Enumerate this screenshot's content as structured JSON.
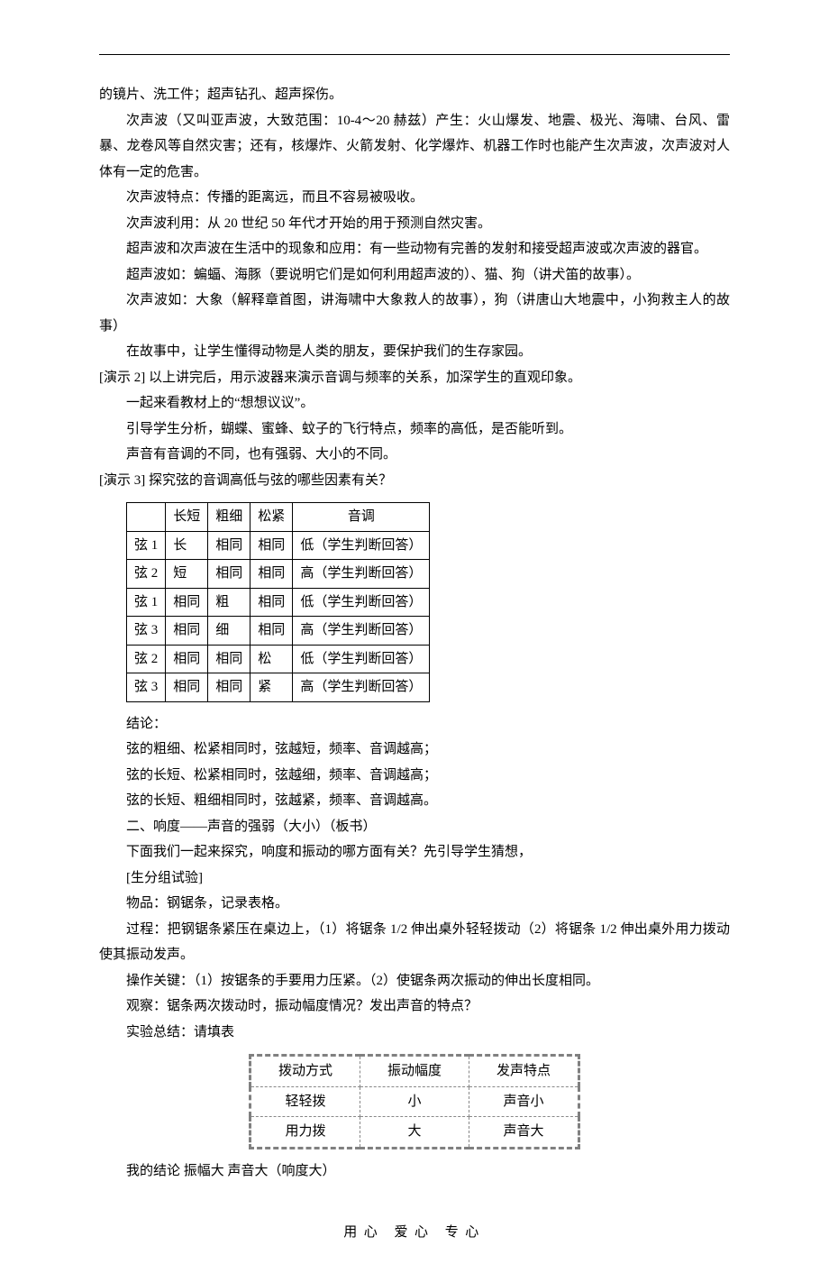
{
  "p": {
    "l01": "的镜片、洗工件；超声钻孔、超声探伤。",
    "l02": "次声波（又叫亚声波，大致范围：10-4～20 赫兹）产生：火山爆发、地震、极光、海啸、台风、雷暴、龙卷风等自然灾害；还有，核爆炸、火箭发射、化学爆炸、机器工作时也能产生次声波，次声波对人体有一定的危害。",
    "l03": "次声波特点：传播的距离远，而且不容易被吸收。",
    "l04": "次声波利用：从 20 世纪 50 年代才开始的用于预测自然灾害。",
    "l05": "超声波和次声波在生活中的现象和应用：有一些动物有完善的发射和接受超声波或次声波的器官。",
    "l06": "超声波如：蝙蝠、海豚（要说明它们是如何利用超声波的）、猫、狗（讲犬笛的故事）。",
    "l07": "次声波如：大象（解释章首图，讲海啸中大象救人的故事），狗（讲唐山大地震中，小狗救主人的故事）",
    "l08": "在故事中，让学生懂得动物是人类的朋友，要保护我们的生存家园。",
    "l09": "[演示 2] 以上讲完后，用示波器来演示音调与频率的关系，加深学生的直观印象。",
    "l10": "一起来看教材上的“想想议议”。",
    "l11": "引导学生分析，蝴蝶、蜜蜂、蚊子的飞行特点，频率的高低，是否能听到。",
    "l12": "声音有音调的不同，也有强弱、大小的不同。",
    "l13": "[演示 3]  探究弦的音调高低与弦的哪些因素有关？",
    "l14": "结论：",
    "l15": "弦的粗细、松紧相同时，弦越短，频率、音调越高；",
    "l16": " 弦的长短、松紧相同时，弦越细，频率、音调越高；",
    "l17": "弦的长短、粗细相同时，弦越紧，频率、音调越高。",
    "l18": "二、响度——声音的强弱（大小）（板书）",
    "l19": "下面我们一起来探究，响度和振动的哪方面有关？先引导学生猜想，",
    "l20": "[生分组试验]",
    "l21": "物品：钢锯条，记录表格。",
    "l22": "过程：把钢锯条紧压在桌边上，（1）将锯条 1/2 伸出桌外轻轻拨动（2）将锯条 1/2 伸出桌外用力拨动 使其振动发声。",
    "l23": "操作关键：（1）按锯条的手要用力压紧。（2）使锯条两次振动的伸出长度相同。",
    "l24": "观察：锯条两次拨动时，振动幅度情况？发出声音的特点？",
    "l25": "实验总结：请填表",
    "l26": "我的结论 振幅大 声音大（响度大）"
  },
  "table1": {
    "headers": [
      "",
      "长短",
      "粗细",
      "松紧",
      "音调"
    ],
    "rows": [
      [
        "弦 1",
        "长",
        "相同",
        "相同",
        "低（学生判断回答）"
      ],
      [
        "弦 2",
        "短",
        "相同",
        "相同",
        "高（学生判断回答）"
      ],
      [
        "弦 1",
        "相同",
        "粗",
        "相同",
        "低（学生判断回答）"
      ],
      [
        "弦 3",
        "相同",
        "细",
        "相同",
        "高（学生判断回答）"
      ],
      [
        "弦 2",
        "相同",
        "相同",
        "松",
        "低（学生判断回答）"
      ],
      [
        "弦 3",
        "相同",
        "相同",
        "紧",
        "高（学生判断回答）"
      ]
    ]
  },
  "table2": {
    "headers": [
      "拨动方式",
      "振动幅度",
      "发声特点"
    ],
    "rows": [
      [
        "轻轻拨",
        "小",
        "声音小"
      ],
      [
        "用力拨",
        "大",
        "声音大"
      ]
    ]
  },
  "footer": "用心 爱心 专心",
  "chart_data": {
    "type": "table",
    "tables": [
      {
        "title": "探究弦的音调高低与弦的哪些因素有关",
        "columns": [
          "弦",
          "长短",
          "粗细",
          "松紧",
          "音调"
        ],
        "rows": [
          [
            "弦 1",
            "长",
            "相同",
            "相同",
            "低"
          ],
          [
            "弦 2",
            "短",
            "相同",
            "相同",
            "高"
          ],
          [
            "弦 1",
            "相同",
            "粗",
            "相同",
            "低"
          ],
          [
            "弦 3",
            "相同",
            "细",
            "相同",
            "高"
          ],
          [
            "弦 2",
            "相同",
            "相同",
            "松",
            "低"
          ],
          [
            "弦 3",
            "相同",
            "相同",
            "紧",
            "高"
          ]
        ]
      },
      {
        "title": "实验总结",
        "columns": [
          "拨动方式",
          "振动幅度",
          "发声特点"
        ],
        "rows": [
          [
            "轻轻拨",
            "小",
            "声音小"
          ],
          [
            "用力拨",
            "大",
            "声音大"
          ]
        ]
      }
    ]
  }
}
